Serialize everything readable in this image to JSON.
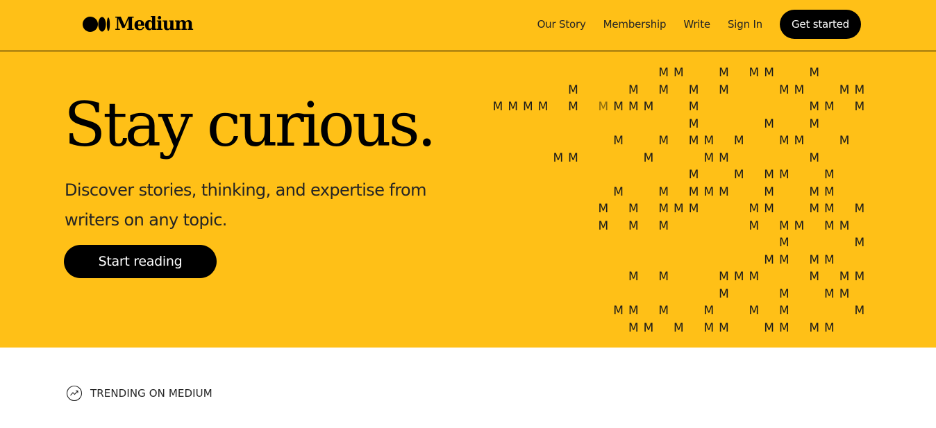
{
  "brand": {
    "name": "Medium",
    "logo_icon": "medium-logo-icon"
  },
  "nav": {
    "links": [
      "Our Story",
      "Membership",
      "Write",
      "Sign In"
    ],
    "cta": "Get started"
  },
  "hero": {
    "title": "Stay curious.",
    "subtitle": "Discover stories, thinking, and expertise from writers on any topic.",
    "button": "Start reading",
    "pattern_letter": "M"
  },
  "trending": {
    "icon": "trending-icon",
    "label": "TRENDING ON MEDIUM"
  },
  "colors": {
    "hero_bg": "#FFC017",
    "button_bg": "#000000",
    "text": "#242424",
    "page_bg": "#FFFFFF"
  }
}
